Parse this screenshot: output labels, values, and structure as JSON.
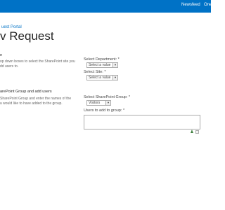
{
  "suitebar": {
    "newsfeed": "Newsfeed",
    "onedrive": "One"
  },
  "breadcrumb": "uest Portal",
  "page_title": "v Request",
  "section1": {
    "title": "e",
    "desc_line1": "op down boxes to select the SharePoint site you",
    "desc_line2": "dd users to."
  },
  "section2": {
    "title": "arePoint Group and add users",
    "desc_line1": "SharePoint Group and enter the names of the",
    "desc_line2": "u would like to have added to the group."
  },
  "form": {
    "department_label": "Select Department: *",
    "department_value": "Select a value",
    "site_label": "Select Site: *",
    "site_value": "Select a value",
    "group_label": "Select SharePoint Group: *",
    "group_value": "Visitors",
    "users_label": "Users to add to group: *"
  }
}
